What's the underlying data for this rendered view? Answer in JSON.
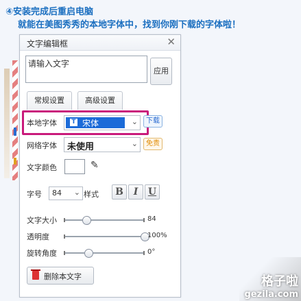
{
  "caption": {
    "line1": "④安装完成后重启电脑",
    "line2": "就能在美图秀秀的本地字体中，找到你刚下载的字体啦！"
  },
  "dialog": {
    "title": "文字编辑框",
    "close_icon": "close-icon",
    "text_input_value": "请输入文字",
    "apply_label": "应用",
    "tabs": [
      {
        "label": "常规设置"
      },
      {
        "label": "高级设置"
      }
    ],
    "local_font": {
      "label": "本地字体",
      "value": "宋体",
      "download_label": "下载"
    },
    "web_font": {
      "label": "网络字体",
      "value": "未使用",
      "free_label": "免责"
    },
    "text_color": {
      "label": "文字颜色",
      "value": "#ffffff",
      "picker_icon": "eyedropper-icon"
    },
    "font_size": {
      "label": "字号",
      "value": "84"
    },
    "style": {
      "label": "样式",
      "bold": "B",
      "italic": "I",
      "underline": "U"
    },
    "sliders": [
      {
        "label": "文字大小",
        "value_text": "84",
        "fraction": 0.28
      },
      {
        "label": "透明度",
        "value_text": "100%",
        "fraction": 1.0
      },
      {
        "label": "旋转角度",
        "value_text": "0°",
        "fraction": 0.31
      }
    ],
    "delete_label": "删除本文字"
  },
  "watermark": {
    "line1": "格子啦",
    "line2": "gezila.com"
  },
  "colors": {
    "caption": "#1b6fc0",
    "highlight": "#c91a7b",
    "selection": "#1c6bd8"
  }
}
